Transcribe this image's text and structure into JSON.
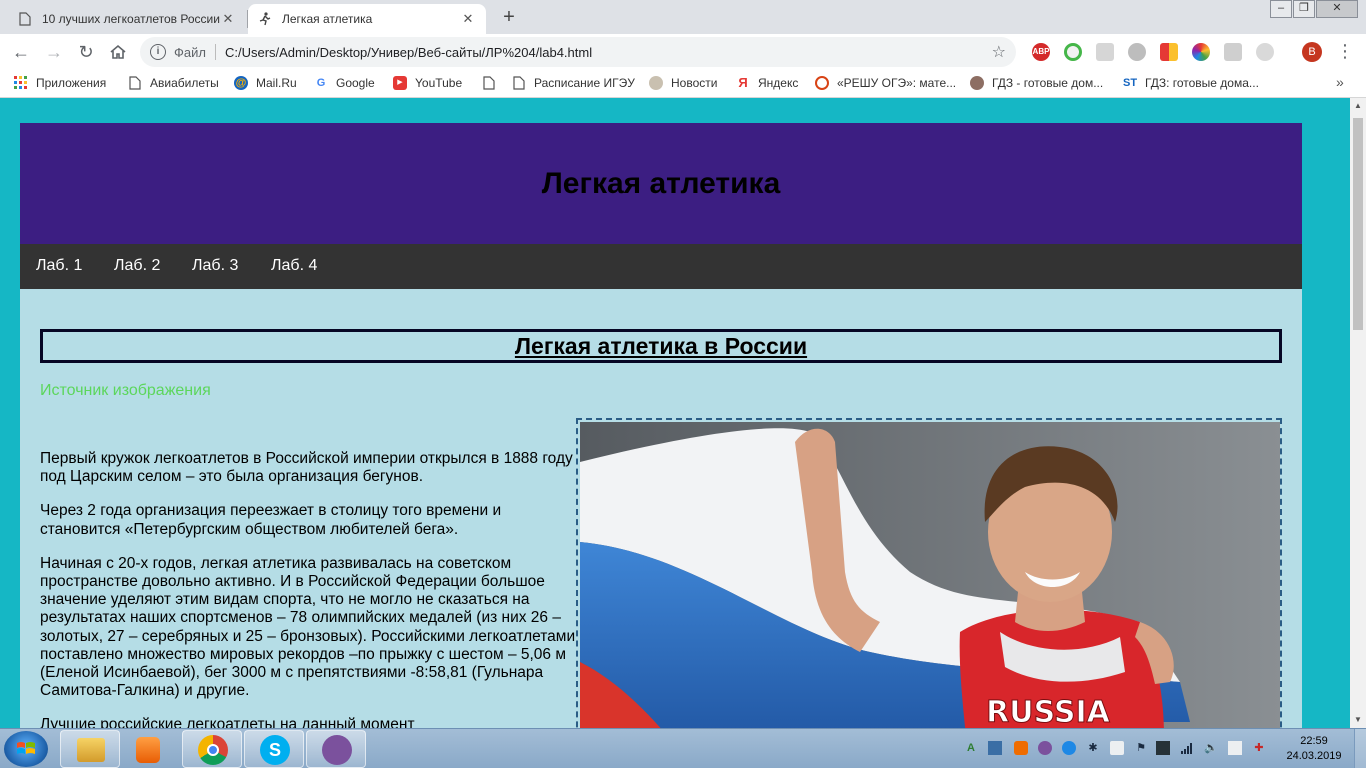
{
  "browser": {
    "tabs": [
      {
        "title": "10 лучших легкоатлетов России",
        "active": false
      },
      {
        "title": "Легкая атлетика",
        "active": true
      }
    ],
    "address": {
      "scheme_label": "Файл",
      "url": "C:/Users/Admin/Desktop/Универ/Веб-сайты/ЛР%204/lab4.html"
    },
    "profile_initial": "B",
    "bookmarks": [
      {
        "label": "Приложения",
        "icon": "apps-icon"
      },
      {
        "label": "Авиабилеты",
        "icon": "page-icon"
      },
      {
        "label": "Mail.Ru",
        "icon": "mailru-icon"
      },
      {
        "label": "Google",
        "icon": "google-icon"
      },
      {
        "label": "YouTube",
        "icon": "youtube-icon"
      },
      {
        "label": "",
        "icon": "page-icon"
      },
      {
        "label": "Расписание ИГЭУ",
        "icon": "page-icon"
      },
      {
        "label": "Новости",
        "icon": "news-icon"
      },
      {
        "label": "Яндекс",
        "icon": "yandex-icon"
      },
      {
        "label": "«РЕШУ ОГЭ»: мате...",
        "icon": "reshu-icon"
      },
      {
        "label": "ГДЗ - готовые дом...",
        "icon": "gdz-icon"
      },
      {
        "label": "ГДЗ: готовые дома...",
        "icon": "st-icon"
      }
    ],
    "colors": {
      "page_bg": "#15b7c5",
      "header_bg": "#3c1e82",
      "nav_bg": "#333333",
      "content_bg": "#b5dde6",
      "link": "#5cd65c"
    }
  },
  "site": {
    "header_title": "Легкая атлетика",
    "nav": [
      "Лаб. 1",
      "Лаб. 2",
      "Лаб. 3",
      "Лаб. 4"
    ],
    "section_title": "Легкая атлетика в России",
    "source_link": "Источник изображения",
    "paragraphs": [
      "Первый кружок легкоатлетов в Российской империи открылся в 1888 году под Царским селом – это была организация бегунов.",
      "Через 2 года организация переезжает в столицу того времени и становится «Петербургским обществом любителей бега».",
      "Начиная с 20-х годов, легкая атлетика развивалась на советском пространстве довольно активно. И в Российской Федерации большое значение уделяют этим видам спорта, что не могло не сказаться на результатах наших спортсменов – 78 олимпийских медалей (из них 26 – золотых, 27 – серебряных и 25 – бронзовых). Российскими легкоатлетами поставлено множество мировых рекордов –по прыжку с шестом – 5,06 м (Еленой Исинбаевой), бег 3000 м с препятствиями -8:58,81 (Гульнара Самитова-Галкина) и другие.",
      "Лучшие российские легкоатлеты на данный момент"
    ],
    "photo_text": "RUSSIA"
  },
  "taskbar": {
    "apps": [
      "explorer-icon",
      "media-player-icon",
      "chrome-icon",
      "skype-icon",
      "viber-icon"
    ],
    "time": "22:59",
    "date": "24.03.2019"
  }
}
